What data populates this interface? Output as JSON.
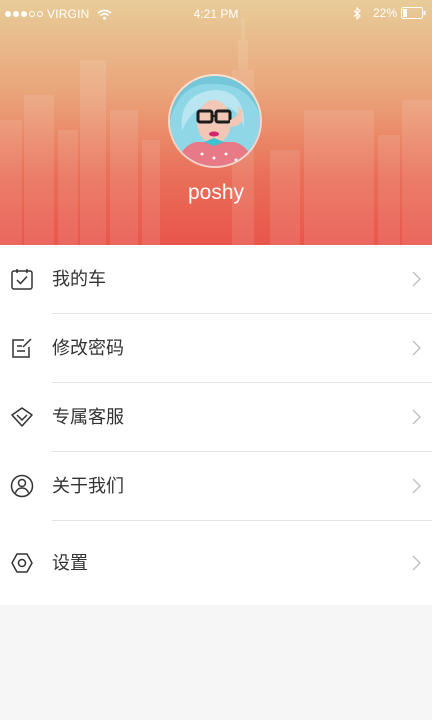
{
  "status_bar": {
    "carrier": "VIRGIN",
    "time": "4:21 PM",
    "battery_percent": "22%",
    "signal_bars_filled": 3,
    "signal_bars_total": 5,
    "battery_level": 0.22
  },
  "profile": {
    "username": "poshy"
  },
  "menu": {
    "items": [
      {
        "label": "我的车",
        "icon": "car-checklist-icon"
      },
      {
        "label": "修改密码",
        "icon": "edit-note-icon"
      },
      {
        "label": "专属客服",
        "icon": "diamond-icon"
      },
      {
        "label": "关于我们",
        "icon": "user-circle-icon"
      },
      {
        "label": "设置",
        "icon": "settings-gear-icon"
      }
    ]
  },
  "colors": {
    "header_top": "#e8cc98",
    "header_bottom": "#e9554b",
    "text": "#333333",
    "divider": "#e3e3e3",
    "page_background": "#f6f6f6"
  }
}
